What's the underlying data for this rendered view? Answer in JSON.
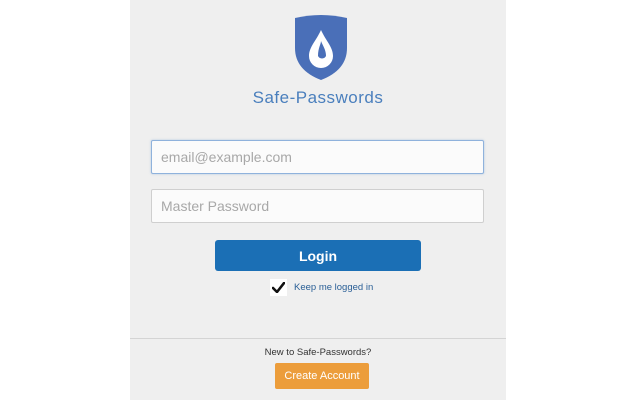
{
  "app": {
    "title": "Safe-Passwords",
    "logo_icon": "shield-droplet-icon"
  },
  "login_form": {
    "email_placeholder": "email@example.com",
    "email_value": "",
    "password_placeholder": "Master Password",
    "password_value": "",
    "login_label": "Login",
    "keep_logged_in_label": "Keep me logged in",
    "keep_logged_in_checked": true
  },
  "signup": {
    "prompt": "New to Safe-Passwords?",
    "create_account_label": "Create Account"
  },
  "colors": {
    "brand_blue": "#4a6fb8",
    "login_button": "#1b6fb5",
    "create_button": "#ec9d3b",
    "panel_background": "#efefef"
  }
}
